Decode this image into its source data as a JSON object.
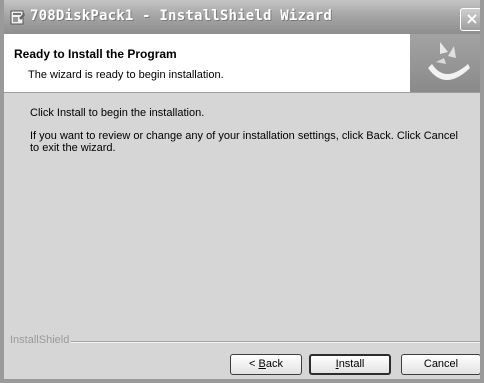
{
  "window": {
    "title": "708DiskPack1 - InstallShield Wizard",
    "close_glyph": "×"
  },
  "header": {
    "title": "Ready to Install the Program",
    "subtitle": "The wizard is ready to begin installation.",
    "logo_icon": "installshield-logo-icon"
  },
  "body": {
    "line1": "Click Install to begin the installation.",
    "line2": "If you want to review or change any of your installation settings, click Back. Click Cancel to exit the wizard."
  },
  "footer": {
    "brand": "InstallShield"
  },
  "buttons": {
    "back_prefix": "< ",
    "back_mnemonic": "B",
    "back_rest": "ack",
    "install_mnemonic": "I",
    "install_rest": "nstall",
    "cancel": "Cancel"
  }
}
